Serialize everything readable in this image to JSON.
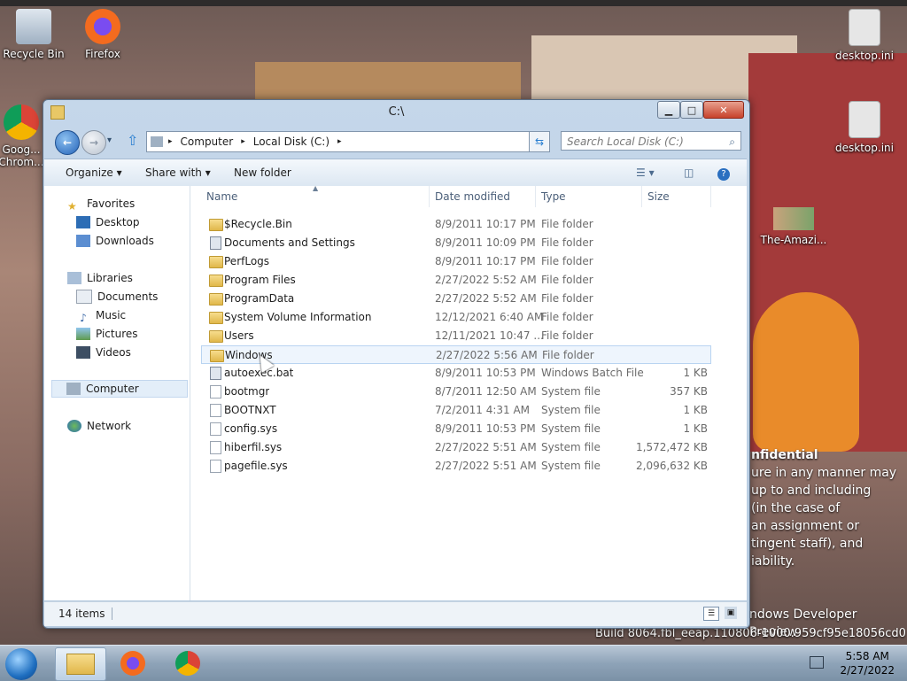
{
  "desktop": {
    "icons": [
      {
        "label": "Recycle Bin"
      },
      {
        "label": "Firefox"
      },
      {
        "label": "Goog... Chrom..."
      },
      {
        "label": "desktop.ini"
      },
      {
        "label": "desktop.ini"
      },
      {
        "label": "The-Amazi..."
      }
    ],
    "overlay_lines": [
      "nfidential",
      "ure in any manner may",
      "up to and including",
      "(in the case of",
      "an assignment or",
      "tingent staff), and",
      "iability."
    ],
    "build_line1": "ndows Developer Preview",
    "build_line2": "Build 8064.fbl_eeap.110806-1000.959cf95e18056cd0"
  },
  "taskbar": {
    "time": "5:58 AM",
    "date": "2/27/2022"
  },
  "window": {
    "title": "C:\\",
    "address": {
      "crumbs": [
        "Computer",
        "Local Disk (C:)"
      ]
    },
    "search_placeholder": "Search Local Disk (C:)",
    "toolbar": {
      "organize": "Organize ▾",
      "share_with": "Share with ▾",
      "new_folder": "New folder"
    },
    "nav": {
      "favorites": "Favorites",
      "desktop": "Desktop",
      "downloads": "Downloads",
      "libraries": "Libraries",
      "documents": "Documents",
      "music": "Music",
      "pictures": "Pictures",
      "videos": "Videos",
      "computer": "Computer",
      "network": "Network"
    },
    "columns": {
      "name": "Name",
      "date": "Date modified",
      "type": "Type",
      "size": "Size"
    },
    "files": [
      {
        "name": "$Recycle.Bin",
        "date": "8/9/2011 10:17 PM",
        "type": "File folder",
        "size": ""
      },
      {
        "name": "Documents and Settings",
        "date": "8/9/2011 10:09 PM",
        "type": "File folder",
        "size": ""
      },
      {
        "name": "PerfLogs",
        "date": "8/9/2011 10:17 PM",
        "type": "File folder",
        "size": ""
      },
      {
        "name": "Program Files",
        "date": "2/27/2022 5:52 AM",
        "type": "File folder",
        "size": ""
      },
      {
        "name": "ProgramData",
        "date": "2/27/2022 5:52 AM",
        "type": "File folder",
        "size": ""
      },
      {
        "name": "System Volume Information",
        "date": "12/12/2021 6:40 AM",
        "type": "File folder",
        "size": ""
      },
      {
        "name": "Users",
        "date": "12/11/2021 10:47 ...",
        "type": "File folder",
        "size": ""
      },
      {
        "name": "Windows",
        "date": "2/27/2022 5:56 AM",
        "type": "File folder",
        "size": ""
      },
      {
        "name": "autoexec.bat",
        "date": "8/9/2011 10:53 PM",
        "type": "Windows Batch File",
        "size": "1 KB"
      },
      {
        "name": "bootmgr",
        "date": "8/7/2011 12:50 AM",
        "type": "System file",
        "size": "357 KB"
      },
      {
        "name": "BOOTNXT",
        "date": "7/2/2011 4:31 AM",
        "type": "System file",
        "size": "1 KB"
      },
      {
        "name": "config.sys",
        "date": "8/9/2011 10:53 PM",
        "type": "System file",
        "size": "1 KB"
      },
      {
        "name": "hiberfil.sys",
        "date": "2/27/2022 5:51 AM",
        "type": "System file",
        "size": "1,572,472 KB"
      },
      {
        "name": "pagefile.sys",
        "date": "2/27/2022 5:51 AM",
        "type": "System file",
        "size": "2,096,632 KB"
      }
    ],
    "status": "14 items"
  }
}
